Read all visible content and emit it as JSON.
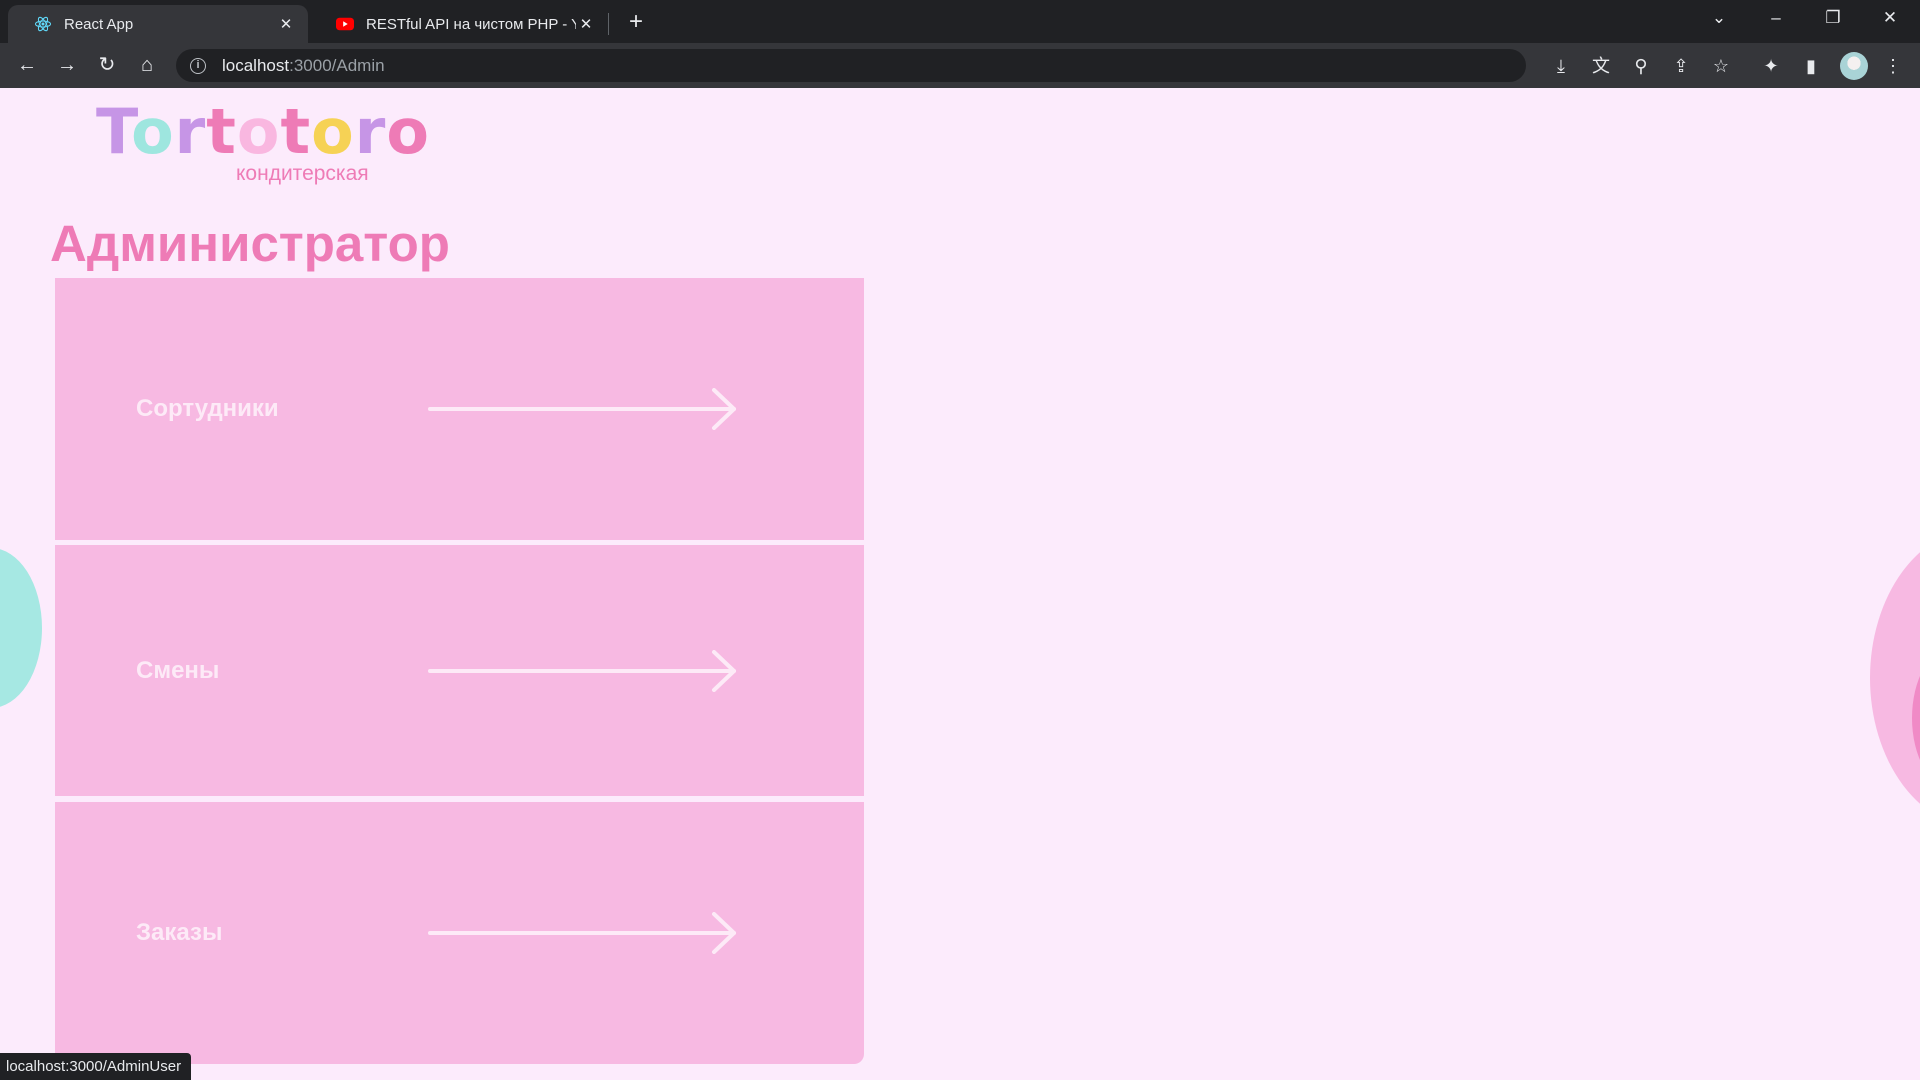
{
  "browser": {
    "tabs": [
      {
        "title": "React App",
        "close": "✕",
        "active": true
      },
      {
        "title": "RESTful API на чистом PHP - You",
        "close": "✕",
        "active": false
      }
    ],
    "new_tab": "+",
    "url_host": "localhost",
    "url_path": ":3000/Admin",
    "status_url": "localhost:3000/AdminUser"
  },
  "logo": {
    "letters": [
      {
        "char": "T",
        "color": "#c695e6"
      },
      {
        "char": "o",
        "color": "#9ee6df"
      },
      {
        "char": "r",
        "color": "#c695e6"
      },
      {
        "char": "t",
        "color": "#ee7bb6"
      },
      {
        "char": "o",
        "color": "#f9b7e0"
      },
      {
        "char": "t",
        "color": "#ee7bb6"
      },
      {
        "char": "o",
        "color": "#f6d255"
      },
      {
        "char": "r",
        "color": "#c695e6"
      },
      {
        "char": "o",
        "color": "#ee7bb6"
      }
    ],
    "subtitle": "кондитерская"
  },
  "page": {
    "title": "Администратор",
    "menu": [
      {
        "label": "Сортудники"
      },
      {
        "label": "Смены"
      },
      {
        "label": "Заказы"
      }
    ]
  },
  "colors": {
    "background": "#fcebfc",
    "card": "#f7b9e2",
    "accent": "#ee7bb6",
    "card_text": "#fdeaf7"
  }
}
